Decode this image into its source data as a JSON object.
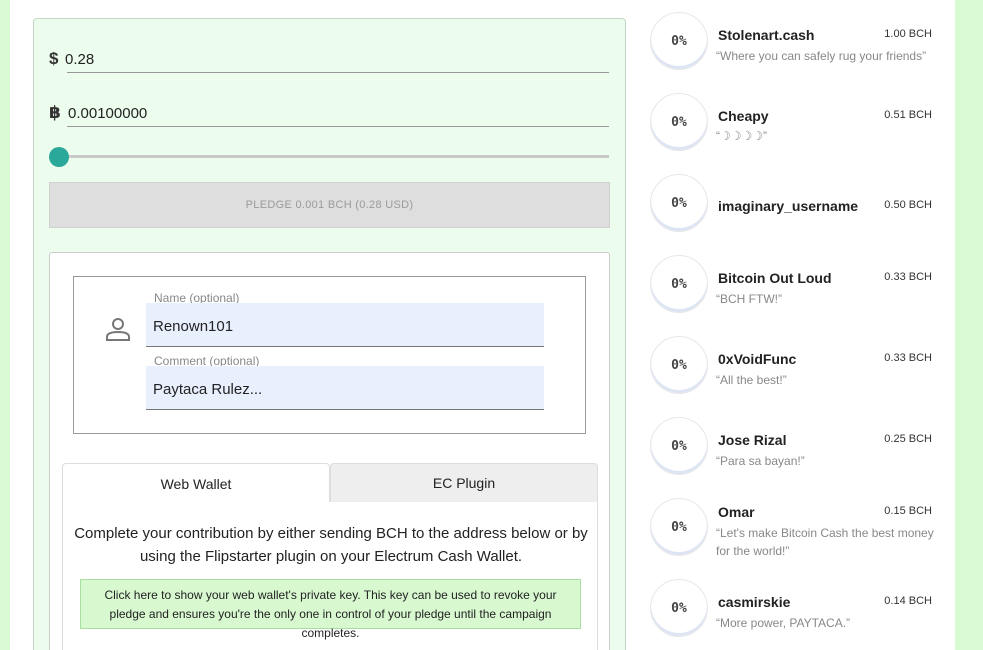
{
  "pledge_form": {
    "usd_symbol": "$",
    "usd_value": "0.28",
    "bch_symbol": "฿",
    "bch_value": "0.00100000",
    "pledge_button": "PLEDGE 0.001 BCH (0.28 USD)",
    "slider_fraction": 0
  },
  "contributor": {
    "name_label": "Name (optional)",
    "name_value": "Renown101",
    "comment_label": "Comment (optional)",
    "comment_value": "Paytaca Rulez..."
  },
  "tabs": [
    {
      "label": "Web Wallet",
      "active": true
    },
    {
      "label": "EC Plugin",
      "active": false
    }
  ],
  "web_wallet": {
    "description": "Complete your contribution by either sending BCH to the address below or by using the Flipstarter plugin on your Electrum Cash Wallet.",
    "notice": "Click here to show your web wallet's private key. This key can be used to revoke your pledge and ensures you're the only one in control of your pledge until the campaign completes."
  },
  "backers": [
    {
      "percent": "0%",
      "name": "Stolenart.cash",
      "amount": "1.00 BCH",
      "comment": "“Where you can safely rug your friends”"
    },
    {
      "percent": "0%",
      "name": "Cheapy",
      "amount": "0.51 BCH",
      "comment": "“☽☽☽☽”"
    },
    {
      "percent": "0%",
      "name": "imaginary_username",
      "amount": "0.50 BCH",
      "comment": ""
    },
    {
      "percent": "0%",
      "name": "Bitcoin Out Loud",
      "amount": "0.33 BCH",
      "comment": "“BCH FTW!”"
    },
    {
      "percent": "0%",
      "name": "0xVoidFunc",
      "amount": "0.33 BCH",
      "comment": "“All the best!”"
    },
    {
      "percent": "0%",
      "name": "Jose Rizal",
      "amount": "0.25 BCH",
      "comment": "“Para sa bayan!”"
    },
    {
      "percent": "0%",
      "name": "Omar",
      "amount": "0.15 BCH",
      "comment": "“Let's make Bitcoin Cash the best money for the world!”"
    },
    {
      "percent": "0%",
      "name": "casmirskie",
      "amount": "0.14 BCH",
      "comment": "“More power, PAYTACA.”"
    }
  ],
  "colors": {
    "accent": "#2aa89a",
    "panel_bg": "#edfded",
    "page_bg": "#d9fbd3",
    "notice_bg": "#d8f8d0",
    "input_bg": "#e8f0fe"
  }
}
